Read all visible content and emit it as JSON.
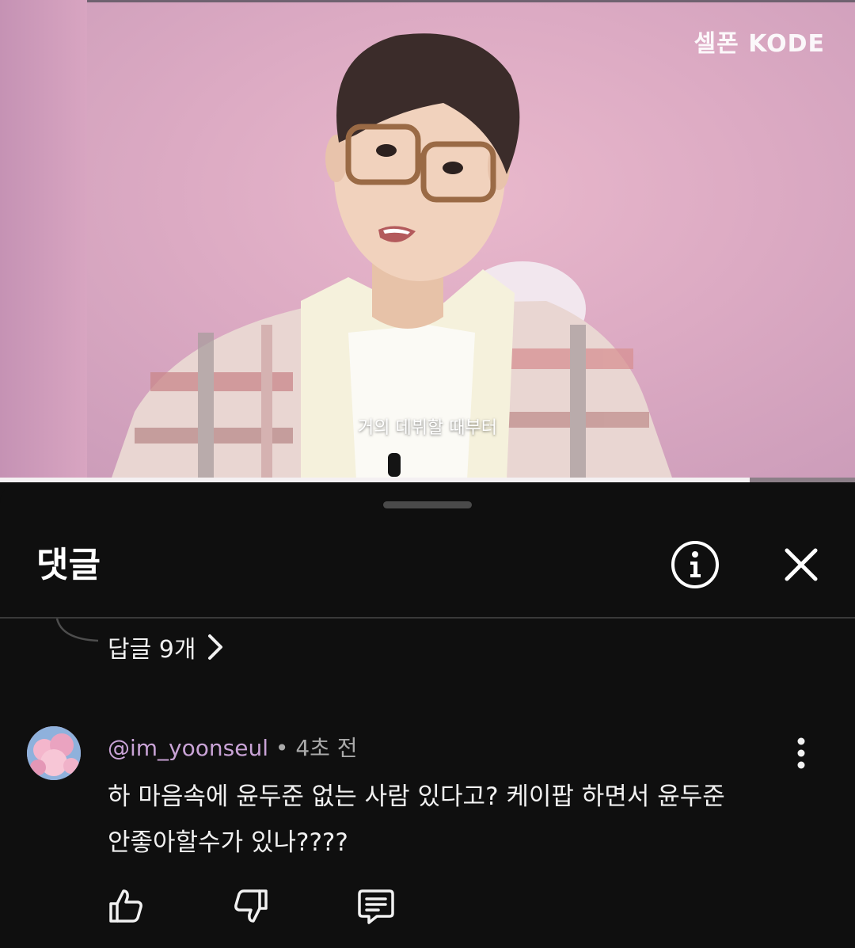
{
  "video": {
    "channel_logo": "셀폰 KODE",
    "subtitle": "거의 데뷔할 때부터",
    "progress_fraction": 0.877
  },
  "comments_sheet": {
    "title": "댓글",
    "icons": {
      "info": "info-icon",
      "close": "close-icon"
    },
    "replies_link": {
      "label": "답글 9개",
      "icon": "chevron-right-icon"
    },
    "comment": {
      "handle": "@im_yoonseul",
      "separator": "•",
      "time": "4초 전",
      "text_line1": "하 마음속에 윤두준 없는 사람 있다고? 케이팝 하면서 윤두준",
      "text_line2": "안좋아할수가 있나????",
      "actions": [
        "like-icon",
        "dislike-icon",
        "reply-icon"
      ],
      "menu_icon": "more-vertical-icon"
    }
  },
  "colors": {
    "background": "#0f0f0f",
    "video_pink": "#dcaac3",
    "handle": "#c9a3d6",
    "meta_text": "#aaaaaa"
  }
}
